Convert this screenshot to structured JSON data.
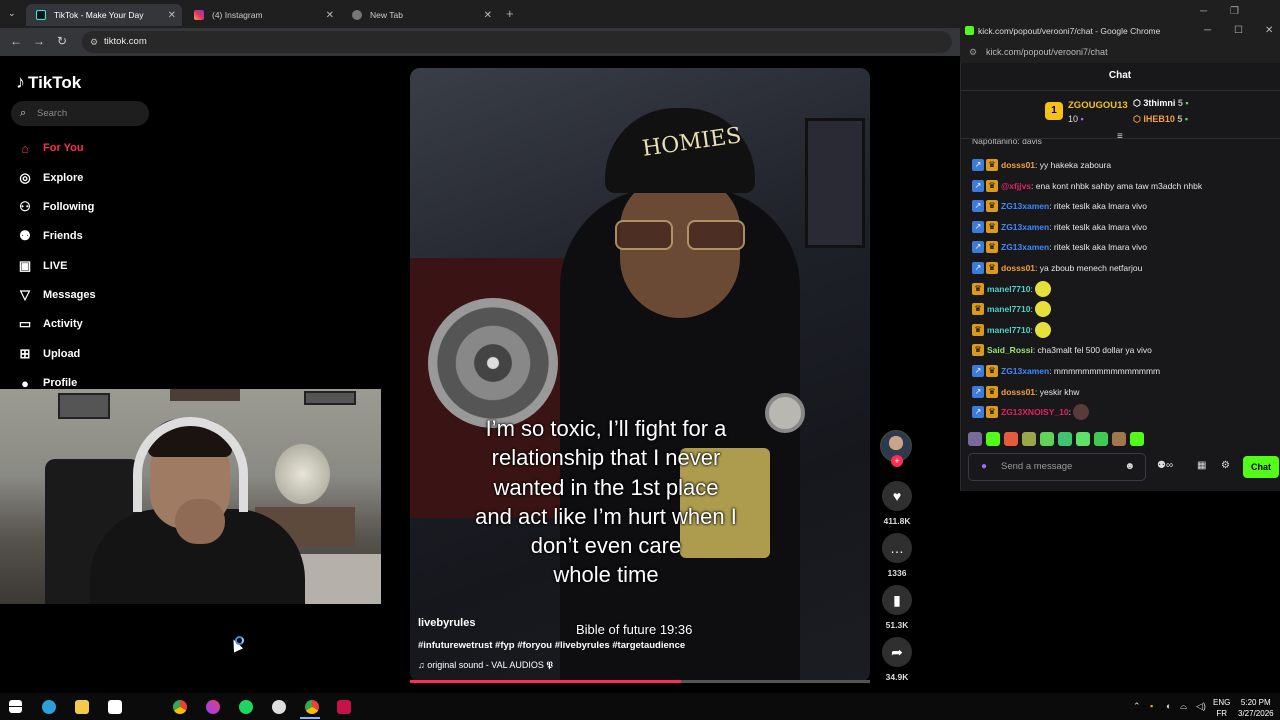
{
  "browser": {
    "tabs": [
      {
        "title": "TikTok - Make Your Day",
        "active": true,
        "icon": "tiktok-icon"
      },
      {
        "title": "(4) Instagram",
        "active": false,
        "icon": "instagram-icon"
      },
      {
        "title": "New Tab",
        "active": false,
        "icon": "chrome-icon"
      }
    ],
    "address": "tiktok.com",
    "new_tab_symbol": "+"
  },
  "tiktok": {
    "logo_text": "TikTok",
    "search_placeholder": "Search",
    "nav": [
      {
        "label": "For You",
        "icon": "home-icon",
        "active": true
      },
      {
        "label": "Explore",
        "icon": "compass-icon"
      },
      {
        "label": "Following",
        "icon": "following-icon"
      },
      {
        "label": "Friends",
        "icon": "friends-icon"
      },
      {
        "label": "LIVE",
        "icon": "live-icon"
      },
      {
        "label": "Messages",
        "icon": "messages-icon"
      },
      {
        "label": "Activity",
        "icon": "activity-icon"
      },
      {
        "label": "Upload",
        "icon": "upload-icon"
      },
      {
        "label": "Profile",
        "icon": "profile-icon"
      }
    ],
    "video": {
      "caption_lines": [
        "I’m so toxic, I’ll fight for a",
        "relationship that I never",
        "wanted in the 1st place",
        "and act like I’m hurt when I",
        "don’t even care",
        "whole time"
      ],
      "overlay_text": "Bible of future 19:36",
      "hat_text": "HOMIES",
      "author": "livebyrules",
      "hashtags": "#infuturewetrust #fyp #foryou #livebyrules #targetaudience",
      "sound": "original sound - VAL AUDIOS 𝕻",
      "progress": 0.59
    },
    "actions": {
      "likes": "411.8K",
      "comments": "1336",
      "saves": "51.3K",
      "shares": "34.9K"
    }
  },
  "kick": {
    "window_title": "kick.com/popout/verooni7/chat - Google Chrome",
    "url": "kick.com/popout/verooni7/chat",
    "panel_title": "Chat",
    "leaderboard": [
      {
        "rank": "1",
        "name": "ZGOUGOU13",
        "count": "10"
      },
      {
        "name": "3thimni",
        "count": "5"
      },
      {
        "name": "IHEB10",
        "count": "5"
      }
    ],
    "partial_line": "Napoltanino: davis",
    "messages": [
      {
        "user": "dosss01",
        "text": ": yy hakeka zaboura",
        "color": "#f59e42",
        "badges": 2
      },
      {
        "user": "@xfjjvs",
        "text": ": ena kont nhbk sahby ama taw m3adch nhbk",
        "color": "#e0245e",
        "badges": 2
      },
      {
        "user": "ZG13xamen",
        "text": ": ritek teslk aka lmara vivo",
        "color": "#3d8bfd",
        "badges": 2
      },
      {
        "user": "ZG13xamen",
        "text": ": ritek teslk aka lmara vivo",
        "color": "#3d8bfd",
        "badges": 2
      },
      {
        "user": "ZG13xamen",
        "text": ": ritek teslk aka lmara vivo",
        "color": "#3d8bfd",
        "badges": 2
      },
      {
        "user": "dosss01",
        "text": ": ya zboub menech netfarjou",
        "color": "#f59e42",
        "badges": 2
      },
      {
        "user": "manel7710",
        "text": ":",
        "color": "#4fd1c5",
        "badges": 1,
        "emote": true
      },
      {
        "user": "manel7710",
        "text": ":",
        "color": "#4fd1c5",
        "badges": 1,
        "emote": true
      },
      {
        "user": "manel7710",
        "text": ":",
        "color": "#4fd1c5",
        "badges": 1,
        "emote": true
      },
      {
        "user": "Said_Rossi",
        "text": ": cha3malt fel 500 dollar ya vivo",
        "color": "#9ae66e",
        "badges": 1
      },
      {
        "user": "ZG13xamen",
        "text": ": mmmmmmmmmmmmmmm",
        "color": "#3d8bfd",
        "badges": 2
      },
      {
        "user": "dosss01",
        "text": ": yeskir khw",
        "color": "#f59e42",
        "badges": 2
      },
      {
        "user": "ZG13XNOISY_10",
        "text": ":",
        "color": "#e0245e",
        "badges": 2,
        "emote": true
      }
    ],
    "input_placeholder": "Send a message",
    "send_label": "Chat"
  },
  "taskbar": {
    "lang_top": "ENG",
    "lang_bottom": "FR",
    "time": "5:20 PM",
    "date": "3/27/2026"
  }
}
